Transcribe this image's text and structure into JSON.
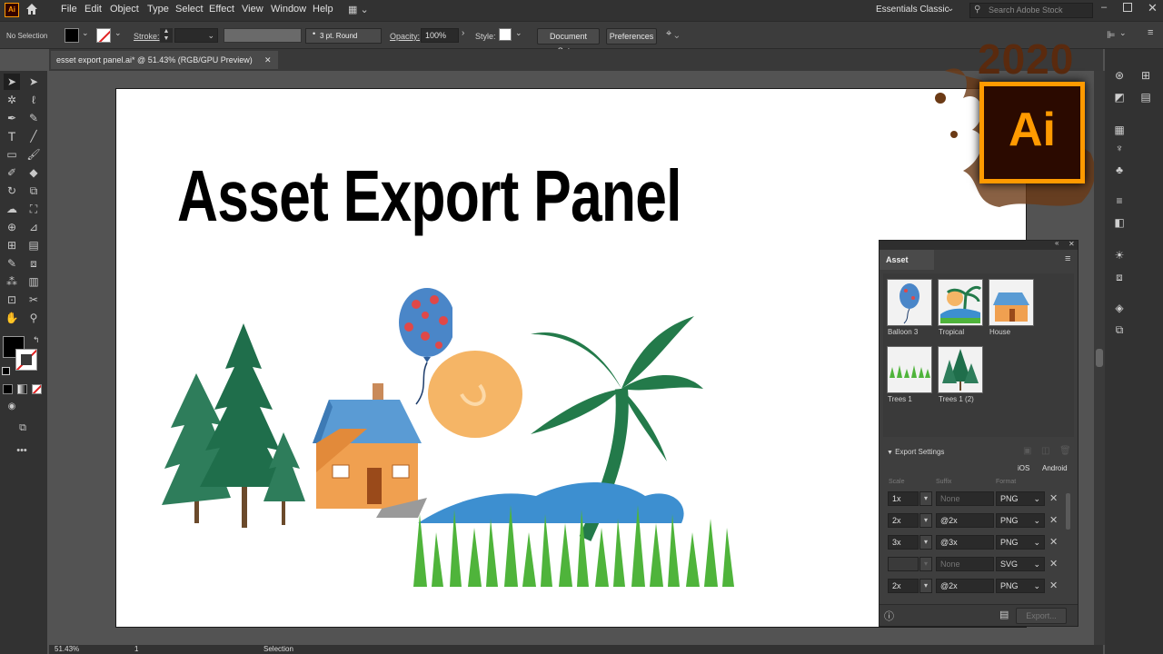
{
  "app": {
    "logo": "Ai"
  },
  "menubar": {
    "items": [
      "File",
      "Edit",
      "Object",
      "Type",
      "Select",
      "Effect",
      "View",
      "Window",
      "Help"
    ],
    "workspace": "Essentials Classic",
    "search_placeholder": "Search Adobe Stock"
  },
  "control": {
    "selection": "No Selection",
    "stroke_label": "Stroke:",
    "brush": "3 pt. Round",
    "opacity_label": "Opacity:",
    "opacity_value": "100%",
    "style_label": "Style:",
    "doc_setup": "Document Setup",
    "preferences": "Preferences"
  },
  "document": {
    "tab_title": "esset export panel.ai* @ 51.43% (RGB/GPU Preview)"
  },
  "artboard": {
    "heading": "Asset Export Panel"
  },
  "badge": {
    "year": "2020",
    "logo": "Ai"
  },
  "panel": {
    "title": "Asset Export",
    "assets": [
      {
        "label": "Balloon 3"
      },
      {
        "label": "Tropical"
      },
      {
        "label": "House"
      },
      {
        "label": "Trees 1"
      },
      {
        "label": "Trees 1 (2)"
      }
    ],
    "export_settings": {
      "title": "Export Settings",
      "ios": "iOS",
      "android": "Android",
      "headers": {
        "scale": "Scale",
        "suffix": "Suffix",
        "format": "Format"
      },
      "rows": [
        {
          "scale": "1x",
          "suffix": "",
          "suffix_placeholder": "None",
          "format": "PNG"
        },
        {
          "scale": "2x",
          "suffix": "@2x",
          "suffix_placeholder": "",
          "format": "PNG"
        },
        {
          "scale": "3x",
          "suffix": "@3x",
          "suffix_placeholder": "",
          "format": "PNG"
        },
        {
          "scale": "",
          "suffix": "",
          "suffix_placeholder": "None",
          "format": "SVG"
        },
        {
          "scale": "2x",
          "suffix": "@2x",
          "suffix_placeholder": "",
          "format": "PNG"
        }
      ]
    },
    "export_button": "Export..."
  },
  "status": {
    "zoom": "51.43%",
    "artboard_num": "1",
    "mode": "Selection"
  },
  "colors": {
    "accent_orange": "#ff9a00",
    "ai_bg": "#330000",
    "fill": "#000000"
  }
}
